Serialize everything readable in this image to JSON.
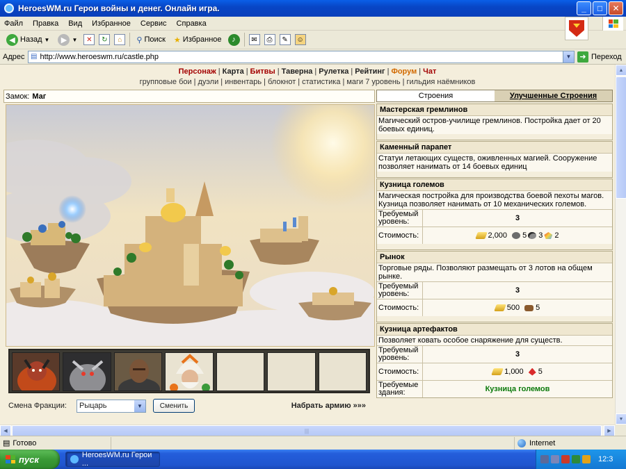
{
  "window": {
    "title": "HeroesWM.ru Герои войны и денег. Онлайн игра."
  },
  "menu": [
    "Файл",
    "Правка",
    "Вид",
    "Избранное",
    "Сервис",
    "Справка"
  ],
  "toolbar": {
    "back": "Назад",
    "search": "Поиск",
    "favorites": "Избранное"
  },
  "address": {
    "label": "Адрес",
    "url": "http://www.heroeswm.ru/castle.php",
    "go": "Переход"
  },
  "nav": {
    "main": [
      {
        "label": "Персонаж",
        "style": "red"
      },
      {
        "label": "Карта",
        "style": "lnk"
      },
      {
        "label": "Битвы",
        "style": "red"
      },
      {
        "label": "Таверна",
        "style": "lnk"
      },
      {
        "label": "Рулетка",
        "style": "lnk"
      },
      {
        "label": "Рейтинг",
        "style": "lnk"
      },
      {
        "label": "Форум",
        "style": "orange"
      },
      {
        "label": "Чат",
        "style": "red"
      }
    ],
    "sub": [
      "групповые бои",
      "дуэли",
      "инвентарь",
      "блокнот",
      "статистика",
      "маги 7 уровень",
      "гильдия наёмников"
    ]
  },
  "castle": {
    "label": "Замок:",
    "name": "Маг"
  },
  "faction": {
    "label": "Смена Фракции:",
    "selected": "Рыцарь",
    "button": "Сменить",
    "recruit": "Набрать армию »»»"
  },
  "tabs": {
    "buildings": "Строения",
    "upgrades": "Улучшенные Строения"
  },
  "buildings": [
    {
      "title": "Мастерская гремлинов",
      "desc": "Магический остров-училище гремлинов. Постройка дает от 20 боевых единиц."
    },
    {
      "title": "Каменный парапет",
      "desc": "Статуи летающих существ, оживленных магией. Сооружение позволяет нанимать от 14 боевых единиц"
    },
    {
      "title": "Кузница големов",
      "desc": "Магическая постройка для производства боевой пехоты магов. Кузница позволяет нанимать от 10 механических големов.",
      "req_label": "Требуемый уровень:",
      "req_value": "3",
      "cost_label": "Стоимость:",
      "cost": [
        {
          "icon": "gold",
          "value": "2,000"
        },
        {
          "icon": "ore",
          "value": "5"
        },
        {
          "icon": "mercury",
          "value": "3"
        },
        {
          "icon": "gem",
          "value": "2"
        }
      ]
    },
    {
      "title": "Рынок",
      "desc": "Торговые ряды. Позволяют размещать от 3 лотов на общем рынке.",
      "req_label": "Требуемый уровень:",
      "req_value": "3",
      "cost_label": "Стоимость:",
      "cost": [
        {
          "icon": "gold",
          "value": "500"
        },
        {
          "icon": "wood",
          "value": "5"
        }
      ]
    },
    {
      "title": "Кузница артефактов",
      "desc": "Позволяет ковать особое снаряжение для существ.",
      "req_label": "Требуемый уровень:",
      "req_value": "3",
      "cost_label": "Стоимость:",
      "cost": [
        {
          "icon": "gold",
          "value": "1,000"
        },
        {
          "icon": "crystal",
          "value": "5"
        }
      ],
      "building_label": "Требуемые здания:",
      "building_value": "Кузница големов"
    }
  ],
  "status": {
    "text": "Готово",
    "zone": "Internet"
  },
  "taskbar": {
    "start": "пуск",
    "task": "HeroesWM.ru Герои ...",
    "clock": "12:3"
  }
}
